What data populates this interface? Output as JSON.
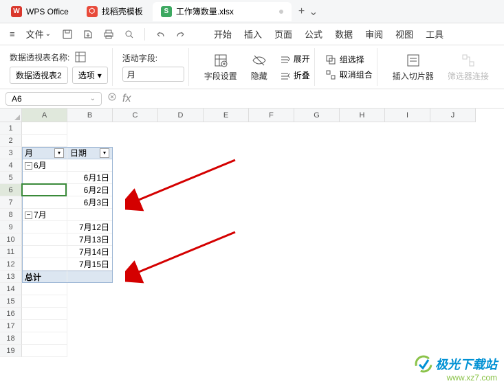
{
  "tabs": {
    "t1": {
      "label": "WPS Office",
      "icon_bg": "#d9372c",
      "icon_text": "W"
    },
    "t2": {
      "label": "找稻壳模板",
      "icon_bg": "#e84a3a",
      "icon_text": "⬡"
    },
    "t3": {
      "label": "工作簿数量.xlsx",
      "icon_bg": "#3da861",
      "icon_text": "S"
    },
    "plus": "+",
    "chevron": "⌄"
  },
  "menu": {
    "hamburger": "≡",
    "file": "文件",
    "chevron": "⌄",
    "tabs": [
      "开始",
      "插入",
      "页面",
      "公式",
      "数据",
      "审阅",
      "视图",
      "工具"
    ]
  },
  "ribbon": {
    "pvname_label": "数据透视表名称:",
    "pvname_value": "数据透视表2",
    "options": "选项",
    "active_field": "活动字段:",
    "field_value": "月",
    "field_settings": "字段设置",
    "hide": "隐藏",
    "expand": "展开",
    "collapse": "折叠",
    "group_sel": "组选择",
    "ungroup": "取消组合",
    "insert_slicer": "插入切片器",
    "filter_conn": "筛选器连接"
  },
  "formula": {
    "namebox": "A6",
    "fx": "fx"
  },
  "columns": [
    "A",
    "B",
    "C",
    "D",
    "E",
    "F",
    "G",
    "H",
    "I",
    "J"
  ],
  "rows": [
    "1",
    "2",
    "3",
    "4",
    "5",
    "6",
    "7",
    "8",
    "9",
    "10",
    "11",
    "12",
    "13",
    "14",
    "15",
    "16",
    "17",
    "18",
    "19"
  ],
  "pivot": {
    "h1": "月",
    "h2": "日期",
    "g1": "6月",
    "g2": "7月",
    "d1": "6月1日",
    "d2": "6月2日",
    "d3": "6月3日",
    "d4": "7月12日",
    "d5": "7月13日",
    "d6": "7月14日",
    "d7": "7月15日",
    "total": "总计",
    "minus": "−"
  },
  "watermark": {
    "cn": "极光下载站",
    "url": "www.xz7.com"
  }
}
